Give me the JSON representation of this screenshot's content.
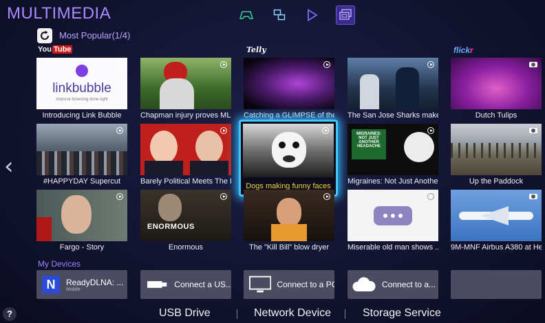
{
  "app_title": "MULTIMEDIA",
  "modes": [
    {
      "icon": "gamepad-icon",
      "color": "#37d39a"
    },
    {
      "icon": "multiscreen-icon",
      "color": "#8fd0ff"
    },
    {
      "icon": "play-icon",
      "color": "#7d6cff"
    },
    {
      "icon": "multimedia-icon",
      "color": "#b3a8ff",
      "active": true
    }
  ],
  "section": {
    "label": "Most Popular(1/4)",
    "refresh_icon": "refresh-icon"
  },
  "providers": {
    "youtube_a": "You",
    "youtube_b": "Tube",
    "telly": "Telly",
    "flickr_a": "flick",
    "flickr_b": "r"
  },
  "tiles": [
    {
      "caption": "Introducing Link Bubble",
      "logo": "linkbubble",
      "tagline": "improve browsing done right"
    },
    {
      "caption": "Chapman injury proves ML..."
    },
    {
      "caption": "Catching a GLIMPSE of the..."
    },
    {
      "caption": "The San Jose Sharks make ..."
    },
    {
      "caption": "Dutch Tulips"
    },
    {
      "caption": "#HAPPYDAY Supercut"
    },
    {
      "caption": "Barely Political Meets The P..."
    },
    {
      "caption": "Dogs making funny faces"
    },
    {
      "caption": "Migraines: Not Just Anothe...",
      "sign": "MIGRAINES: NOT JUST ANOTHER HEADACHE"
    },
    {
      "caption": "Up the Paddock"
    },
    {
      "caption": "Fargo - Story"
    },
    {
      "caption": "Enormous",
      "overlay": "ENORMOUS"
    },
    {
      "caption": "The \"Kill Bill\" blow dryer"
    },
    {
      "caption": "Miserable old man shows ..."
    },
    {
      "caption": "9M-MNF Airbus A380 at He..."
    }
  ],
  "my_devices": {
    "label": "My Devices",
    "items": [
      {
        "icon": "dlna-icon",
        "letter": "N",
        "label": "ReadyDLNA: ...",
        "sub": "Mobile"
      },
      {
        "icon": "usb-icon",
        "label": "Connect a US..."
      },
      {
        "icon": "monitor-icon",
        "label": "Connect to a PC"
      },
      {
        "icon": "cloud-icon",
        "label": "Connect to a..."
      },
      {
        "icon": "",
        "label": ""
      }
    ]
  },
  "bottom_tabs": [
    "USB Drive",
    "Network Device",
    "Storage Service"
  ],
  "help_label": "?",
  "colors": {
    "accent": "#a88cff",
    "focus": "#3fc7ff",
    "focus_caption": "#f6d83a",
    "device_bg": "#4b4c62"
  }
}
